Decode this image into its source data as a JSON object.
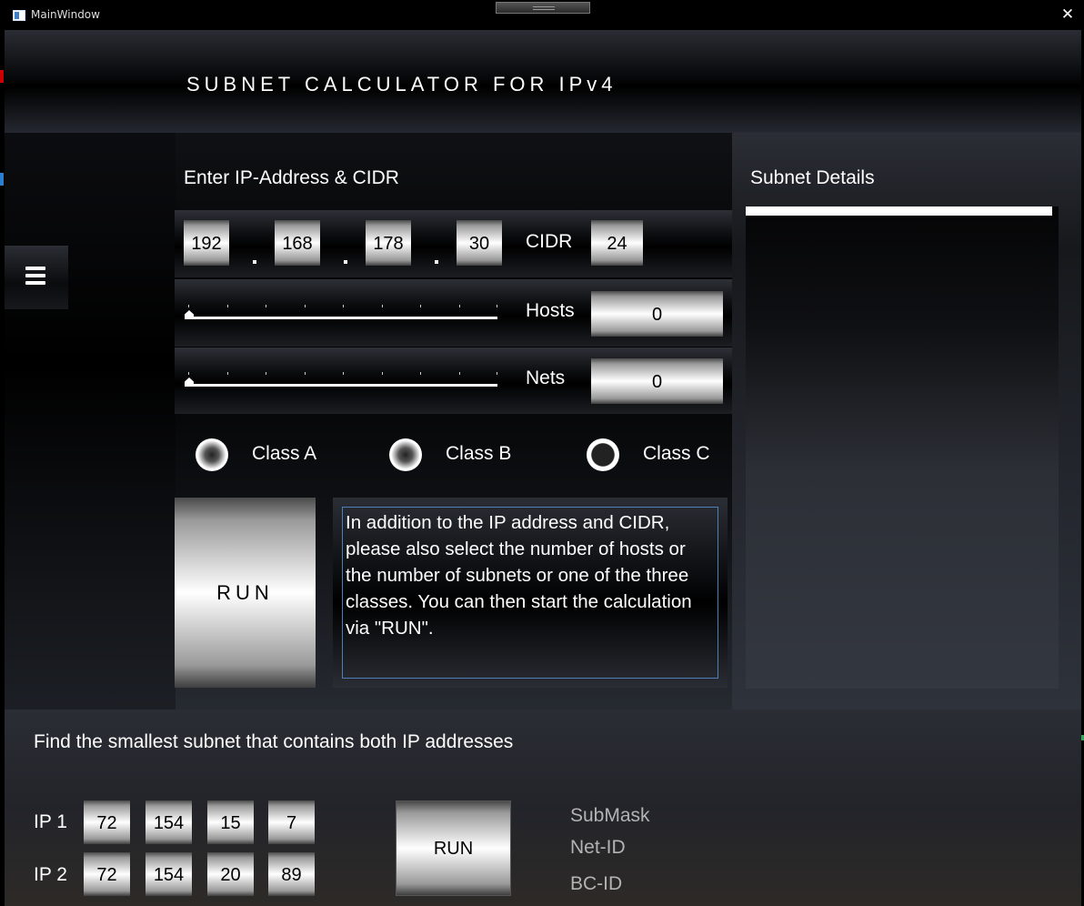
{
  "window": {
    "title": "MainWindow",
    "close_glyph": "✕",
    "icon": "app-window-icon"
  },
  "header": {
    "title": "SUBNET CALCULATOR FOR IPv4"
  },
  "menu": {
    "icon": "hamburger-menu-icon"
  },
  "input": {
    "heading": "Enter IP-Address & CIDR",
    "octets": [
      "192",
      "168",
      "178",
      "30"
    ],
    "separator": ".",
    "cidr_label": "CIDR",
    "cidr_value": "24",
    "hosts_label": "Hosts",
    "hosts_value": "0",
    "hosts_slider_value": 0,
    "nets_label": "Nets",
    "nets_value": "0",
    "nets_slider_value": 0
  },
  "classes": [
    {
      "label": "Class A",
      "selected": false
    },
    {
      "label": "Class B",
      "selected": false
    },
    {
      "label": "Class C",
      "selected": true
    }
  ],
  "run_label": "RUN",
  "info_text": "In addition to the IP address and CIDR, please also select the number of hosts or the number of subnets or one of the three classes. You can then start the calculation via \"RUN\".",
  "subnet_details": {
    "heading": "Subnet Details"
  },
  "bottom": {
    "heading": "Find the smallest subnet that contains both IP addresses",
    "ip1_label": "IP 1",
    "ip1": [
      "72",
      "154",
      "15",
      "7"
    ],
    "ip2_label": "IP 2",
    "ip2": [
      "72",
      "154",
      "20",
      "89"
    ],
    "run_label": "RUN",
    "results": [
      "SubMask",
      "Net-ID",
      "BC-ID"
    ]
  }
}
